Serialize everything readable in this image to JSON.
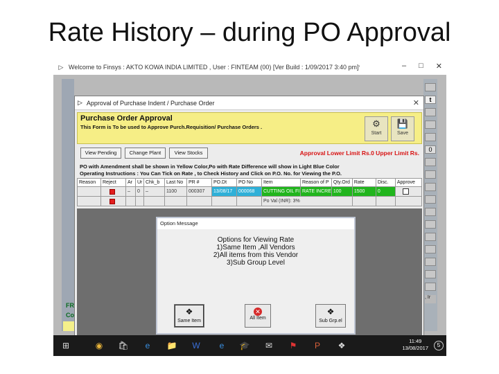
{
  "slide": {
    "title": "Rate History – during PO Approval"
  },
  "app": {
    "title": "Welcome to Finsys : AKTO KOWA INDIA LIMITED , User : FINTEAM (00) [Ver Build : 1/09/2017 3:40 pm]**",
    "controls": [
      "–",
      "□",
      "✕"
    ],
    "right_strip_letter": "t",
    "right_strip_letter2": "0",
    "right_strip_text": ", Ir",
    "fr_lines": [
      "FR",
      "Co"
    ]
  },
  "dialog": {
    "title": "Approval of Purchase Indent / Purchase Order",
    "close": "✕",
    "heading": "Purchase Order Approval",
    "subheading": "This Form is To be used to Approve Purch.Requisition/ Purchase Orders .",
    "start_label": "Start",
    "save_label": "Save",
    "buttons": {
      "view_pending": "View Pending",
      "change_plant": "Change Plant",
      "view_stocks": "View Stocks"
    },
    "limit_text": "Approval Lower Limit Rs.0 Upper Limit Rs.",
    "info1": "PO with Amendment shall be shown in Yellow Color,Po with Rate Difference will show in Light Blue Color",
    "info2": "Operating Instructions : You Can Tick on Rate , to Check History and Click on P.O. No. for Viewing the P.O.",
    "columns": [
      "Reason",
      "Reject",
      "Ar",
      "Ur",
      "Chk_b",
      "Last No",
      "PR #",
      "PO.Dt",
      "PO No",
      "Item",
      "Reason of P",
      "Qty.Ord",
      "Rate",
      "Disc.",
      "Approve"
    ],
    "row1": {
      "ar": "–",
      "ur": "0",
      "chk": "–",
      "last_no": "1100",
      "pr": "000307",
      "po_dt": "13/08/17",
      "po_no": "000068",
      "item": "CUTTING OIL FI",
      "reason": "RATE INCRE",
      "qty": "100",
      "rate": "1500",
      "disc": "0"
    },
    "row2": {
      "item": "Po Val (INR): 3%"
    }
  },
  "option_message": {
    "title": "Option Message",
    "lines": [
      "Options for Viewing Rate",
      "1)Same Item ,All Vendors",
      "2)All items from this Vendor",
      "3)Sub Group Level"
    ],
    "buttons": {
      "same_item": "Same Item",
      "all_item": "All Item",
      "sub_group": "Sub Grp.el"
    }
  },
  "taskbar": {
    "time": "11:49",
    "date": "13/08/2017",
    "notifications": "5"
  }
}
